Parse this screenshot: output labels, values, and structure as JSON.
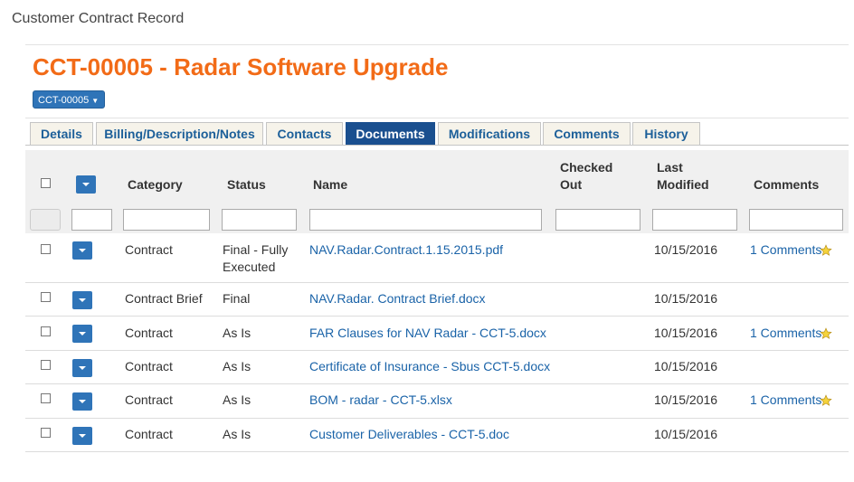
{
  "breadcrumb": "Customer Contract Record",
  "page_title": "CCT-00005 - Radar Software Upgrade",
  "record_button": "CCT-00005",
  "tabs": [
    {
      "label": "Details"
    },
    {
      "label": "Billing/Description/Notes"
    },
    {
      "label": "Contacts"
    },
    {
      "label": "Documents",
      "active": true
    },
    {
      "label": "Modifications"
    },
    {
      "label": "Comments"
    },
    {
      "label": "History"
    }
  ],
  "columns": {
    "category": "Category",
    "status": "Status",
    "name": "Name",
    "checked_out_1": "Checked",
    "checked_out_2": "Out",
    "last_modified_1": "Last",
    "last_modified_2": "Modified",
    "comments": "Comments"
  },
  "rows": [
    {
      "category": "Contract",
      "status_1": "Final - Fully",
      "status_2": "Executed",
      "name": "NAV.Radar.Contract.1.15.2015.pdf",
      "checked_out": "",
      "modified": "10/15/2016",
      "comments": "1 Comments",
      "starred": true
    },
    {
      "category": "Contract Brief",
      "status_1": "Final",
      "status_2": "",
      "name": "NAV.Radar. Contract Brief.docx",
      "checked_out": "",
      "modified": "10/15/2016",
      "comments": "",
      "starred": false
    },
    {
      "category": "Contract",
      "status_1": "As Is",
      "status_2": "",
      "name": "FAR Clauses for NAV Radar - CCT-5.docx",
      "checked_out": "",
      "modified": "10/15/2016",
      "comments": "1 Comments",
      "starred": true
    },
    {
      "category": "Contract",
      "status_1": "As Is",
      "status_2": "",
      "name": "Certificate of Insurance - Sbus CCT-5.docx",
      "checked_out": "",
      "modified": "10/15/2016",
      "comments": "",
      "starred": false
    },
    {
      "category": "Contract",
      "status_1": "As Is",
      "status_2": "",
      "name": "BOM - radar - CCT-5.xlsx",
      "checked_out": "",
      "modified": "10/15/2016",
      "comments": "1 Comments",
      "starred": true
    },
    {
      "category": "Contract",
      "status_1": "As Is",
      "status_2": "",
      "name": "Customer Deliverables - CCT-5.doc",
      "checked_out": "",
      "modified": "10/15/2016",
      "comments": "",
      "starred": false
    }
  ],
  "colors": {
    "title": "#f26b17",
    "active_tab": "#1a4f8f",
    "link": "#1a63a8",
    "button": "#2f74b8"
  }
}
